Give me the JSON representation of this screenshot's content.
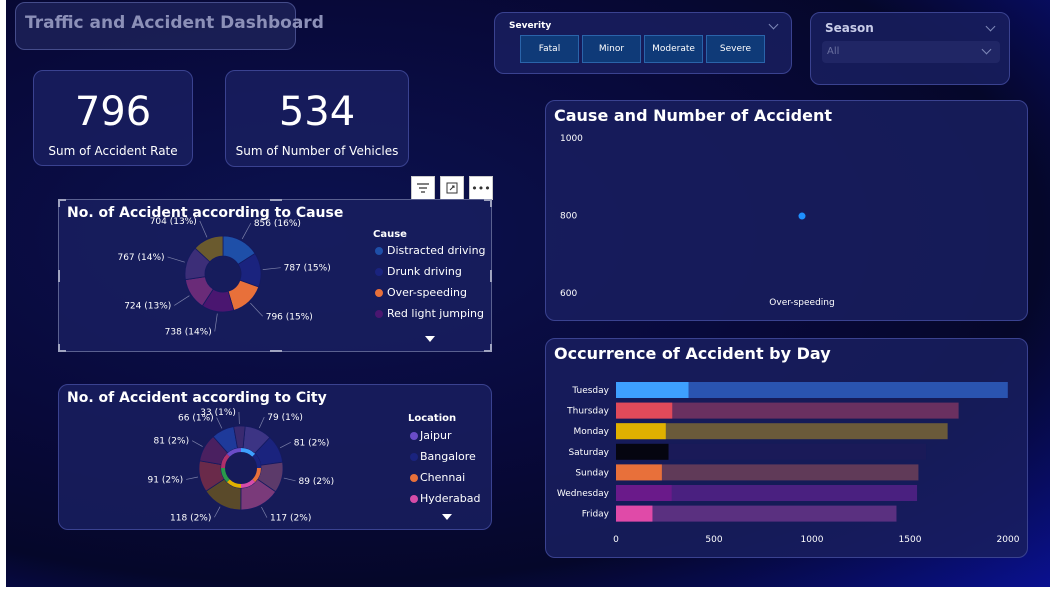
{
  "dashboard": {
    "title": "Traffic and Accident Dashboard"
  },
  "kpis": [
    {
      "value": "796",
      "label": "Sum of Accident Rate"
    },
    {
      "value": "534",
      "label": "Sum of Number of  Vehicles"
    }
  ],
  "severity_slicer": {
    "label": "Severity",
    "options": [
      "Fatal",
      "Minor",
      "Moderate",
      "Severe"
    ]
  },
  "season_slicer": {
    "label": "Season",
    "value": "All"
  },
  "visual_toolbar": {
    "more_label": "•••"
  },
  "cause_donut": {
    "title": "No. of Accident according to Cause",
    "legend_title": "Cause",
    "legend": [
      {
        "name": "Distracted driving",
        "color": "#1e4fa8"
      },
      {
        "name": "Drunk driving",
        "color": "#1a237e"
      },
      {
        "name": "Over-speeding",
        "color": "#e8703a"
      },
      {
        "name": "Red light jumping",
        "color": "#4a1670"
      }
    ],
    "slices": [
      {
        "value": 856,
        "label": "856 (16%)",
        "color": "#1e4fa8"
      },
      {
        "value": 787,
        "label": "787 (15%)",
        "color": "#1a237e"
      },
      {
        "value": 796,
        "label": "796 (15%)",
        "color": "#e8703a"
      },
      {
        "value": 738,
        "label": "738 (14%)",
        "color": "#4a1670"
      },
      {
        "value": 724,
        "label": "724 (13%)",
        "color": "#6a2b78"
      },
      {
        "value": 767,
        "label": "767 (14%)",
        "color": "#3c2e78"
      },
      {
        "value": 704,
        "label": "704 (13%)",
        "color": "#6a5a2e"
      }
    ]
  },
  "city_donut": {
    "title": "No. of Accident according to City",
    "legend_title": "Location",
    "legend": [
      {
        "name": "Jaipur",
        "color": "#6a4cc8"
      },
      {
        "name": "Bangalore",
        "color": "#1a237e"
      },
      {
        "name": "Chennai",
        "color": "#e8703a"
      },
      {
        "name": "Hyderabad",
        "color": "#d64ca8"
      }
    ],
    "slices": [
      {
        "value": 79,
        "label": "79 (1%)",
        "color": "#3c3484"
      },
      {
        "value": 81,
        "label": "81 (2%)",
        "color": "#1a237e"
      },
      {
        "value": 89,
        "label": "89 (2%)",
        "color": "#5c3a6a"
      },
      {
        "value": 117,
        "label": "117 (2%)",
        "color": "#7a3a7a"
      },
      {
        "value": 118,
        "label": "118 (2%)",
        "color": "#5a4a2a"
      },
      {
        "value": 91,
        "label": "91 (2%)",
        "color": "#6a2a4a"
      },
      {
        "value": 81,
        "label": "81 (2%)",
        "color": "#4a2060"
      },
      {
        "value": 66,
        "label": "66 (1%)",
        "color": "#1e3a9a"
      },
      {
        "value": 33,
        "label": "33 (1%)",
        "color": "#3a2a70"
      }
    ],
    "inner_ring_colors": [
      "#3ea0ff",
      "#1a237e",
      "#e8703a",
      "#d64ca8",
      "#e0b000",
      "#2a9a4a",
      "#b0306a",
      "#6a4cc8"
    ]
  },
  "cause_scatter": {
    "title": "Cause and Number of Accident",
    "chart_data": {
      "type": "scatter",
      "categories": [
        "Over-speeding"
      ],
      "values": [
        796
      ],
      "ylim": [
        600,
        1000
      ],
      "yticks": [
        "1000",
        "800",
        "600"
      ]
    }
  },
  "day_bars": {
    "title": "Occurrence of Accident by Day",
    "chart_data": {
      "type": "bar",
      "categories": [
        "Tuesday",
        "Thursday",
        "Monday",
        "Saturday",
        "Sunday",
        "Wednesday",
        "Friday"
      ],
      "totals": [
        1999,
        1748,
        1692,
        1582,
        1543,
        1536,
        1431
      ],
      "highlight": [
        370,
        287,
        254,
        268,
        234,
        284,
        186
      ],
      "colors": [
        "#3ea0ff",
        "#e04a5a",
        "#e0b000",
        "#050510",
        "#e8703a",
        "#6a1a8a",
        "#e04aa8"
      ],
      "bg_colors": [
        "#2a54b0",
        "#6a3060",
        "#6a5a3a",
        "#1a1a58",
        "#603a58",
        "#4a2080",
        "#5a3080"
      ],
      "xlim": [
        0,
        2000
      ],
      "xticks": [
        "0",
        "500",
        "1000",
        "1500",
        "2000"
      ]
    }
  }
}
